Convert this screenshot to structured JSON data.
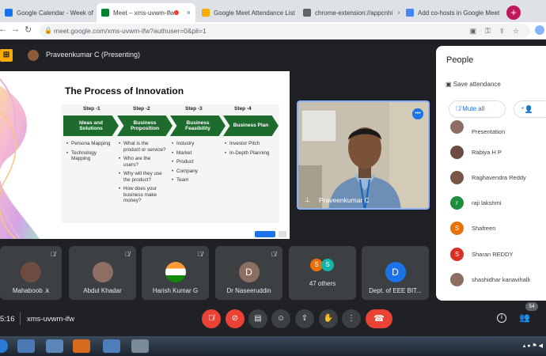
{
  "browser": {
    "tabs": [
      {
        "label": "Google Calendar - Week of Fe",
        "active": false,
        "fav_color": "#1a73e8"
      },
      {
        "label": "Meet – xms-uvwm-ifw",
        "active": true,
        "fav_color": "#00832d"
      },
      {
        "label": "Google Meet Attendance List",
        "active": false,
        "fav_color": "#f9ab00"
      },
      {
        "label": "chrome-extension://appcnhi",
        "active": false,
        "fav_color": "#5f6368"
      },
      {
        "label": "Add co-hosts in Google Meet",
        "active": false,
        "fav_color": "#4285f4"
      }
    ],
    "close_glyph": "×",
    "new_tab_glyph": "+",
    "url": "meet.google.com/xms-uvwm-ifw?authuser=0&pli=1"
  },
  "meet": {
    "presenting_label": "Praveenkumar C (Presenting)",
    "slide": {
      "title": "The Process of Innovation",
      "steps": [
        {
          "label": "Step -1",
          "title": "Ideas and Solutions",
          "bullets": [
            "Persona Mapping",
            "Technology Mapping"
          ]
        },
        {
          "label": "Step -2",
          "title": "Business Proposition",
          "bullets": [
            "What is the product or service?",
            "Who are the users?",
            "Why will they use the product?",
            "How does your business make money?"
          ]
        },
        {
          "label": "Step -3",
          "title": "Business Feasibility",
          "bullets": [
            "Industry",
            "Market",
            "Product",
            "Company",
            "Team"
          ]
        },
        {
          "label": "Step -4",
          "title": "Business Plan",
          "bullets": [
            "Investor Pitch",
            "In-Depth Planning"
          ]
        }
      ]
    },
    "main_video": {
      "name": "Praveenkumar C"
    },
    "participants": [
      {
        "name": "Mahaboob .k",
        "avatar": "",
        "avatar_color": "#6d4c41"
      },
      {
        "name": "Abdul Khadar",
        "avatar": "",
        "avatar_color": "#8d6e63"
      },
      {
        "name": "Harish Kumar G",
        "avatar": "",
        "avatar_color": "#ff9933"
      },
      {
        "name": "Dr Naseeruddin",
        "avatar": "D",
        "avatar_color": "#8d6e63"
      },
      {
        "name": "47 others",
        "avatar": "",
        "avatar_color": "#e8710a"
      },
      {
        "name": "Dept. of EEE BIT...",
        "avatar": "D",
        "avatar_color": "#1a73e8"
      }
    ],
    "others_avatars": [
      "S",
      "S"
    ],
    "people_panel": {
      "title": "People",
      "save_attendance": "Save attendance",
      "mute_all": "Mute all",
      "list": [
        {
          "name": "Presentation",
          "avatar": "",
          "color": "#8d6e63"
        },
        {
          "name": "Rabiya H P",
          "avatar": "",
          "color": "#6d4c41"
        },
        {
          "name": "Raghavendra Reddy",
          "avatar": "",
          "color": "#795548"
        },
        {
          "name": "raji lakshmi",
          "avatar": "r",
          "color": "#1e8e3e"
        },
        {
          "name": "Shafreen",
          "avatar": "S",
          "color": "#e8710a"
        },
        {
          "name": "Sharan REDDY",
          "avatar": "S",
          "color": "#d93025"
        },
        {
          "name": "shashidhar kanavihalli",
          "avatar": "",
          "color": "#8d6e63"
        }
      ]
    },
    "bottom_bar": {
      "time": "5:16",
      "meeting_code": "xms-uvwm-ifw",
      "participant_count": "54"
    }
  },
  "colors": {
    "accent": "#1a73e8",
    "end_call": "#ea4335",
    "chevron_green": "#1e6b2e"
  }
}
